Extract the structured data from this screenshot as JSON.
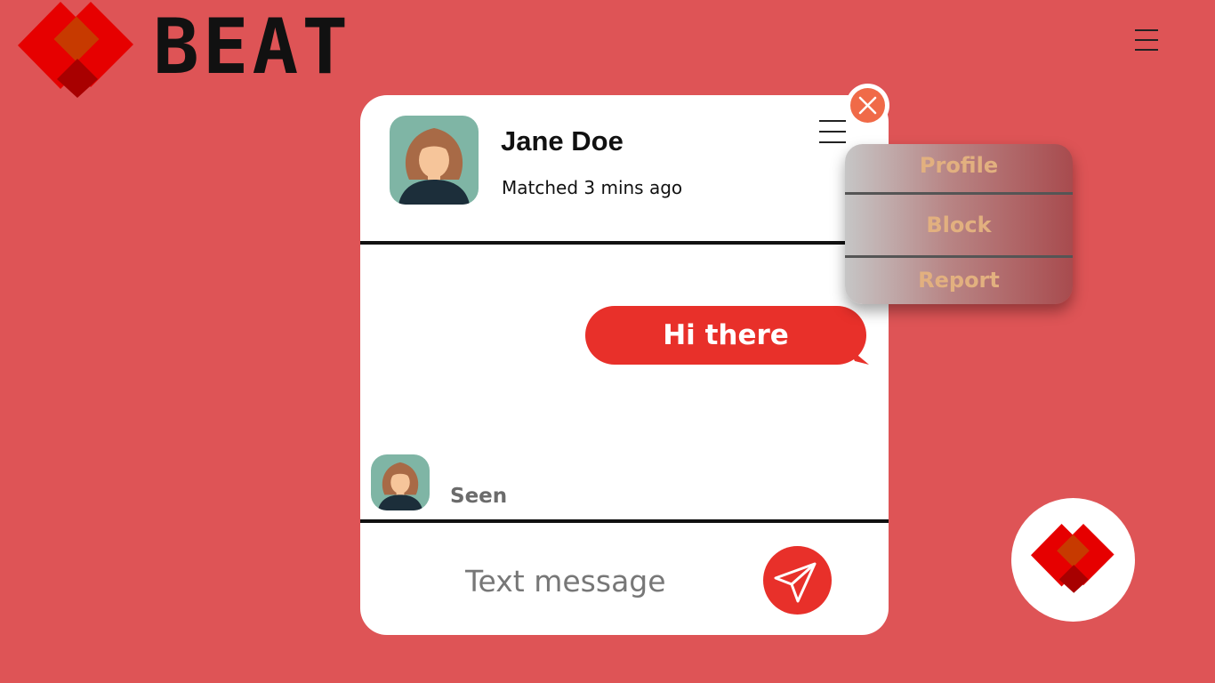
{
  "brand": {
    "name": "BEAT",
    "logo_icon": "heart-diamond-logo",
    "colors": {
      "primary": "#e60000",
      "dark": "#c73a00",
      "shadow": "#a80000"
    }
  },
  "header": {
    "menu_icon": "hamburger-icon"
  },
  "chat": {
    "contact_name": "Jane Doe",
    "contact_status": "Matched 3 mins ago",
    "avatar_icon": "user-avatar-icon",
    "menu_icon": "hamburger-icon",
    "messages": [
      {
        "text": "Hi there",
        "direction": "outgoing",
        "color": "#e8302a"
      }
    ],
    "read_receipt": "Seen",
    "input": {
      "value": "",
      "placeholder": "Text message"
    },
    "send_icon": "paper-plane-icon"
  },
  "dropdown_menu": {
    "items": [
      {
        "label": "Profile"
      },
      {
        "label": "Block"
      },
      {
        "label": "Report"
      }
    ]
  },
  "close_icon": "close-x-icon",
  "theme": {
    "background": "#de5456",
    "card": "#ffffff",
    "accent": "#e8302a",
    "close_button": "#f06a48",
    "menu_text": "#e2b07f",
    "seen_text": "#6b6b6b"
  }
}
